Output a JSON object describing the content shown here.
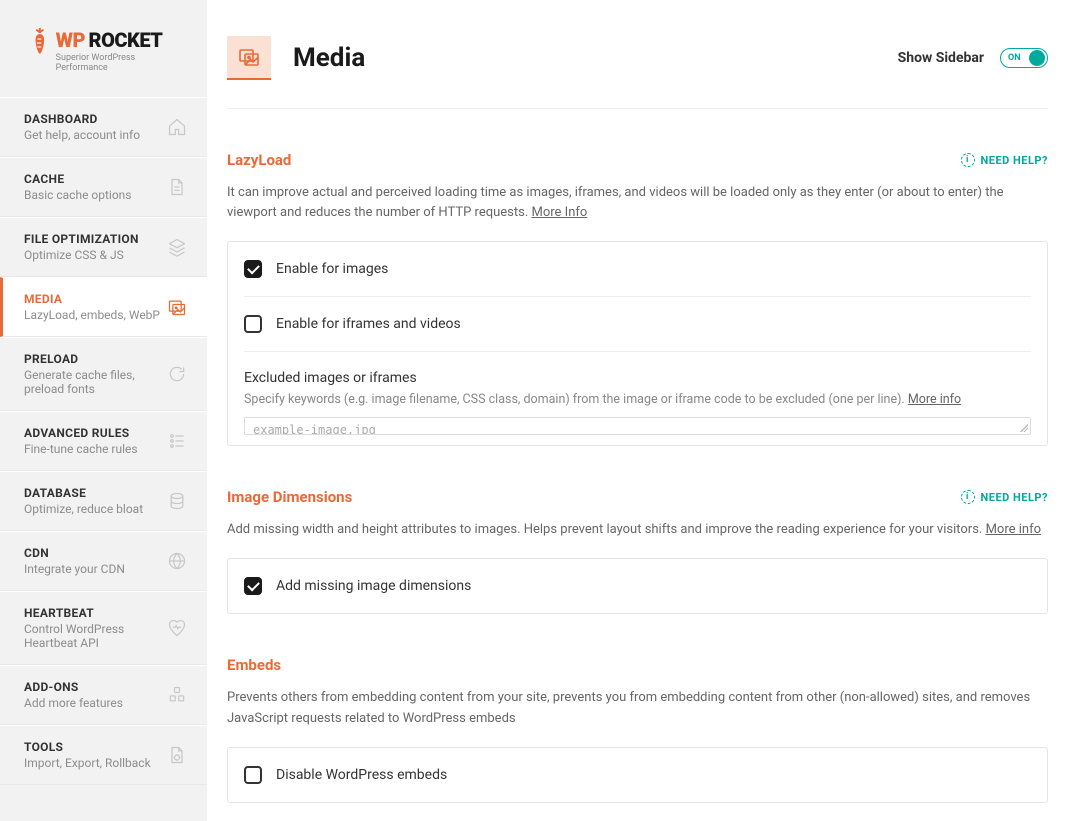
{
  "brand": {
    "prefix": "WP",
    "suffix": "ROCKET",
    "tagline": "Superior WordPress Performance"
  },
  "nav": [
    {
      "title": "DASHBOARD",
      "sub": "Get help, account info",
      "icon": "home"
    },
    {
      "title": "CACHE",
      "sub": "Basic cache options",
      "icon": "file"
    },
    {
      "title": "FILE OPTIMIZATION",
      "sub": "Optimize CSS & JS",
      "icon": "layers"
    },
    {
      "title": "MEDIA",
      "sub": "LazyLoad, embeds, WebP",
      "icon": "media",
      "active": true
    },
    {
      "title": "PRELOAD",
      "sub": "Generate cache files, preload fonts",
      "icon": "refresh"
    },
    {
      "title": "ADVANCED RULES",
      "sub": "Fine-tune cache rules",
      "icon": "rules"
    },
    {
      "title": "DATABASE",
      "sub": "Optimize, reduce bloat",
      "icon": "database"
    },
    {
      "title": "CDN",
      "sub": "Integrate your CDN",
      "icon": "globe"
    },
    {
      "title": "HEARTBEAT",
      "sub": "Control WordPress Heartbeat API",
      "icon": "heartbeat"
    },
    {
      "title": "ADD-ONS",
      "sub": "Add more features",
      "icon": "addons"
    },
    {
      "title": "TOOLS",
      "sub": "Import, Export, Rollback",
      "icon": "tools"
    }
  ],
  "header": {
    "title": "Media",
    "showSidebarLabel": "Show Sidebar",
    "toggleState": "ON"
  },
  "help": {
    "needHelp": "NEED HELP?"
  },
  "sections": {
    "lazyload": {
      "title": "LazyLoad",
      "desc": "It can improve actual and perceived loading time as images, iframes, and videos will be loaded only as they enter (or about to enter) the viewport and reduces the number of HTTP requests. ",
      "moreInfo": "More Info",
      "opt_images": "Enable for images",
      "opt_iframes": "Enable for iframes and videos",
      "excluded_title": "Excluded images or iframes",
      "excluded_sub": "Specify keywords (e.g. image filename, CSS class, domain) from the image or iframe code to be excluded (one per line). ",
      "excluded_more": "More info",
      "placeholder": "example-image.jpg"
    },
    "dimensions": {
      "title": "Image Dimensions",
      "desc": "Add missing width and height attributes to images. Helps prevent layout shifts and improve the reading experience for your visitors. ",
      "moreInfo": "More info",
      "opt_add": "Add missing image dimensions"
    },
    "embeds": {
      "title": "Embeds",
      "desc": "Prevents others from embedding content from your site, prevents you from embedding content from other (non-allowed) sites, and removes JavaScript requests related to WordPress embeds",
      "opt_disable": "Disable WordPress embeds"
    }
  }
}
